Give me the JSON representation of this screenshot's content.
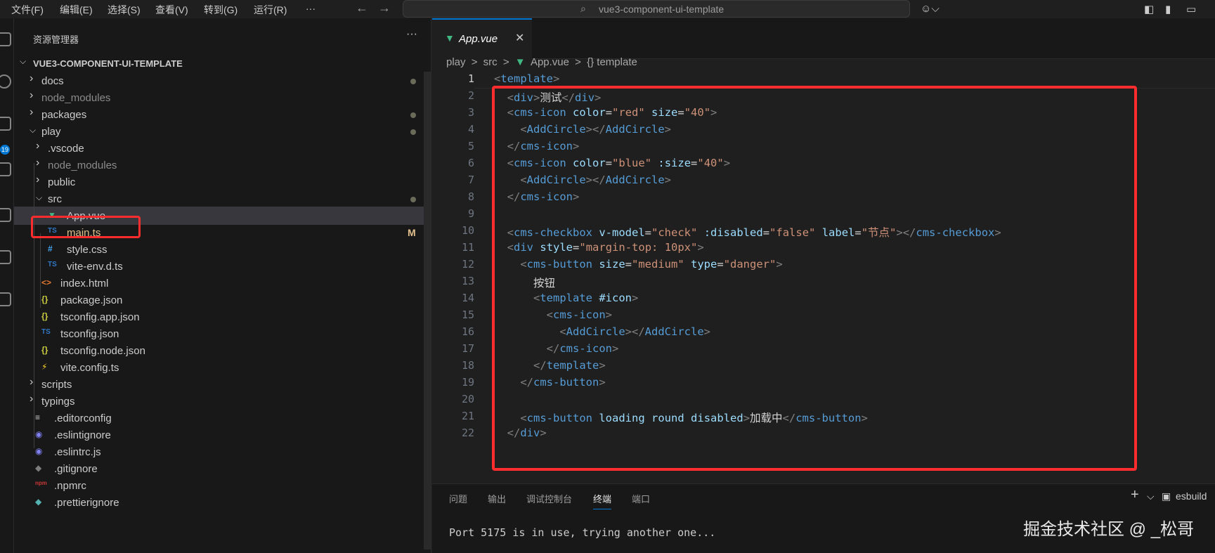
{
  "menu": [
    {
      "label": "文件(F)"
    },
    {
      "label": "编辑(E)"
    },
    {
      "label": "选择(S)"
    },
    {
      "label": "查看(V)"
    },
    {
      "label": "转到(G)"
    },
    {
      "label": "运行(R)"
    },
    {
      "label": "···"
    }
  ],
  "nav": {
    "back": "←",
    "forward": "→"
  },
  "command_center": {
    "icon": "search-icon",
    "text": "vue3-component-ui-template"
  },
  "activity": {
    "badge": "19"
  },
  "sidebar": {
    "title": "资源管理器",
    "more": "···",
    "root": "VUE3-COMPONENT-UI-TEMPLATE",
    "items": [
      {
        "label": "docs",
        "kind": "folder",
        "state": "collapsed",
        "badge": "dot"
      },
      {
        "label": "node_modules",
        "kind": "folder",
        "state": "collapsed",
        "dim": true
      },
      {
        "label": "packages",
        "kind": "folder",
        "state": "collapsed",
        "badge": "dot"
      },
      {
        "label": "play",
        "kind": "folder",
        "state": "expanded",
        "badge": "dot"
      },
      {
        "label": ".vscode",
        "kind": "folder",
        "state": "collapsed"
      },
      {
        "label": "node_modules",
        "kind": "folder",
        "state": "collapsed",
        "dim": true
      },
      {
        "label": "public",
        "kind": "folder",
        "state": "collapsed"
      },
      {
        "label": "src",
        "kind": "folder",
        "state": "expanded",
        "badge": "dot"
      },
      {
        "label": "App.vue",
        "kind": "vue",
        "selected": true
      },
      {
        "label": "main.ts",
        "kind": "ts",
        "icon_text": "TS",
        "badge": "M"
      },
      {
        "label": "style.css",
        "kind": "css",
        "icon_text": "#"
      },
      {
        "label": "vite-env.d.ts",
        "kind": "ts",
        "icon_text": "TS"
      },
      {
        "label": "index.html",
        "kind": "html",
        "icon_text": "<>"
      },
      {
        "label": "package.json",
        "kind": "json",
        "icon_text": "{}"
      },
      {
        "label": "tsconfig.app.json",
        "kind": "json",
        "icon_text": "{}"
      },
      {
        "label": "tsconfig.json",
        "kind": "tsconfig",
        "icon_text": "TS"
      },
      {
        "label": "tsconfig.node.json",
        "kind": "json",
        "icon_text": "{}"
      },
      {
        "label": "vite.config.ts",
        "kind": "vite",
        "icon_text": "⚡"
      },
      {
        "label": "scripts",
        "kind": "folder",
        "state": "collapsed"
      },
      {
        "label": "typings",
        "kind": "folder",
        "state": "collapsed"
      },
      {
        "label": ".editorconfig",
        "kind": "config",
        "icon_text": "≡"
      },
      {
        "label": ".eslintignore",
        "kind": "eslint",
        "icon_text": "◉"
      },
      {
        "label": ".eslintrc.js",
        "kind": "eslint",
        "icon_text": "◉"
      },
      {
        "label": ".gitignore",
        "kind": "git",
        "icon_text": "◆"
      },
      {
        "label": ".npmrc",
        "kind": "npm",
        "icon_text": "npm"
      },
      {
        "label": ".prettierignore",
        "kind": "prettier",
        "icon_text": "◆"
      }
    ]
  },
  "editor": {
    "tab": {
      "label": "App.vue",
      "close": "✕"
    },
    "breadcrumb": [
      "play",
      ">",
      "src",
      ">",
      "App.vue",
      ">",
      "{} template"
    ],
    "active_line": 1,
    "lines": [
      {
        "n": "1",
        "tokens": [
          [
            "pc",
            "<"
          ],
          [
            "tg",
            "template"
          ],
          [
            "pc",
            ">"
          ]
        ]
      },
      {
        "n": "2",
        "tokens": [
          [
            "tx",
            "  "
          ],
          [
            "pc",
            "<"
          ],
          [
            "tg",
            "div"
          ],
          [
            "pc",
            ">"
          ],
          [
            "tx",
            "测试"
          ],
          [
            "pc",
            "</"
          ],
          [
            "tg",
            "div"
          ],
          [
            "pc",
            ">"
          ]
        ]
      },
      {
        "n": "3",
        "tokens": [
          [
            "tx",
            "  "
          ],
          [
            "pc",
            "<"
          ],
          [
            "tg",
            "cms-icon"
          ],
          [
            "tx",
            " "
          ],
          [
            "at",
            "color"
          ],
          [
            "tx",
            "="
          ],
          [
            "sv",
            "\"red\""
          ],
          [
            "tx",
            " "
          ],
          [
            "at",
            "size"
          ],
          [
            "tx",
            "="
          ],
          [
            "sv",
            "\"40\""
          ],
          [
            "pc",
            ">"
          ]
        ]
      },
      {
        "n": "4",
        "tokens": [
          [
            "tx",
            "    "
          ],
          [
            "pc",
            "<"
          ],
          [
            "tg",
            "AddCircle"
          ],
          [
            "pc",
            "></"
          ],
          [
            "tg",
            "AddCircle"
          ],
          [
            "pc",
            ">"
          ]
        ]
      },
      {
        "n": "5",
        "tokens": [
          [
            "tx",
            "  "
          ],
          [
            "pc",
            "</"
          ],
          [
            "tg",
            "cms-icon"
          ],
          [
            "pc",
            ">"
          ]
        ]
      },
      {
        "n": "6",
        "tokens": [
          [
            "tx",
            "  "
          ],
          [
            "pc",
            "<"
          ],
          [
            "tg",
            "cms-icon"
          ],
          [
            "tx",
            " "
          ],
          [
            "at",
            "color"
          ],
          [
            "tx",
            "="
          ],
          [
            "sv",
            "\"blue\""
          ],
          [
            "tx",
            " "
          ],
          [
            "at",
            ":size"
          ],
          [
            "tx",
            "="
          ],
          [
            "sv",
            "\"40\""
          ],
          [
            "pc",
            ">"
          ]
        ]
      },
      {
        "n": "7",
        "tokens": [
          [
            "tx",
            "    "
          ],
          [
            "pc",
            "<"
          ],
          [
            "tg",
            "AddCircle"
          ],
          [
            "pc",
            "></"
          ],
          [
            "tg",
            "AddCircle"
          ],
          [
            "pc",
            ">"
          ]
        ]
      },
      {
        "n": "8",
        "tokens": [
          [
            "tx",
            "  "
          ],
          [
            "pc",
            "</"
          ],
          [
            "tg",
            "cms-icon"
          ],
          [
            "pc",
            ">"
          ]
        ]
      },
      {
        "n": "9",
        "tokens": []
      },
      {
        "n": "10",
        "tokens": [
          [
            "tx",
            "  "
          ],
          [
            "pc",
            "<"
          ],
          [
            "tg",
            "cms-checkbox"
          ],
          [
            "tx",
            " "
          ],
          [
            "at",
            "v-model"
          ],
          [
            "tx",
            "="
          ],
          [
            "sv",
            "\"check\""
          ],
          [
            "tx",
            " "
          ],
          [
            "at",
            ":disabled"
          ],
          [
            "tx",
            "="
          ],
          [
            "sv",
            "\"false\""
          ],
          [
            "tx",
            " "
          ],
          [
            "at",
            "label"
          ],
          [
            "tx",
            "="
          ],
          [
            "sv",
            "\"节点\""
          ],
          [
            "pc",
            "></"
          ],
          [
            "tg",
            "cms-checkbox"
          ],
          [
            "pc",
            ">"
          ]
        ]
      },
      {
        "n": "11",
        "tokens": [
          [
            "tx",
            "  "
          ],
          [
            "pc",
            "<"
          ],
          [
            "tg",
            "div"
          ],
          [
            "tx",
            " "
          ],
          [
            "at",
            "style"
          ],
          [
            "tx",
            "="
          ],
          [
            "sv",
            "\"margin-top: 10px\""
          ],
          [
            "pc",
            ">"
          ]
        ]
      },
      {
        "n": "12",
        "tokens": [
          [
            "tx",
            "    "
          ],
          [
            "pc",
            "<"
          ],
          [
            "tg",
            "cms-button"
          ],
          [
            "tx",
            " "
          ],
          [
            "at",
            "size"
          ],
          [
            "tx",
            "="
          ],
          [
            "sv",
            "\"medium\""
          ],
          [
            "tx",
            " "
          ],
          [
            "at",
            "type"
          ],
          [
            "tx",
            "="
          ],
          [
            "sv",
            "\"danger\""
          ],
          [
            "pc",
            ">"
          ]
        ]
      },
      {
        "n": "13",
        "tokens": [
          [
            "tx",
            "      按钮"
          ]
        ]
      },
      {
        "n": "14",
        "tokens": [
          [
            "tx",
            "      "
          ],
          [
            "pc",
            "<"
          ],
          [
            "tg",
            "template"
          ],
          [
            "tx",
            " "
          ],
          [
            "at",
            "#icon"
          ],
          [
            "pc",
            ">"
          ]
        ]
      },
      {
        "n": "15",
        "tokens": [
          [
            "tx",
            "        "
          ],
          [
            "pc",
            "<"
          ],
          [
            "tg",
            "cms-icon"
          ],
          [
            "pc",
            ">"
          ]
        ]
      },
      {
        "n": "16",
        "tokens": [
          [
            "tx",
            "          "
          ],
          [
            "pc",
            "<"
          ],
          [
            "tg",
            "AddCircle"
          ],
          [
            "pc",
            "></"
          ],
          [
            "tg",
            "AddCircle"
          ],
          [
            "pc",
            ">"
          ]
        ]
      },
      {
        "n": "17",
        "tokens": [
          [
            "tx",
            "        "
          ],
          [
            "pc",
            "</"
          ],
          [
            "tg",
            "cms-icon"
          ],
          [
            "pc",
            ">"
          ]
        ]
      },
      {
        "n": "18",
        "tokens": [
          [
            "tx",
            "      "
          ],
          [
            "pc",
            "</"
          ],
          [
            "tg",
            "template"
          ],
          [
            "pc",
            ">"
          ]
        ]
      },
      {
        "n": "19",
        "tokens": [
          [
            "tx",
            "    "
          ],
          [
            "pc",
            "</"
          ],
          [
            "tg",
            "cms-button"
          ],
          [
            "pc",
            ">"
          ]
        ]
      },
      {
        "n": "20",
        "tokens": []
      },
      {
        "n": "21",
        "tokens": [
          [
            "tx",
            "    "
          ],
          [
            "pc",
            "<"
          ],
          [
            "tg",
            "cms-button"
          ],
          [
            "tx",
            " "
          ],
          [
            "at",
            "loading"
          ],
          [
            "tx",
            " "
          ],
          [
            "at",
            "round"
          ],
          [
            "tx",
            " "
          ],
          [
            "at",
            "disabled"
          ],
          [
            "pc",
            ">"
          ],
          [
            "tx",
            "加载中"
          ],
          [
            "pc",
            "</"
          ],
          [
            "tg",
            "cms-button"
          ],
          [
            "pc",
            ">"
          ]
        ]
      },
      {
        "n": "22",
        "tokens": [
          [
            "tx",
            "  "
          ],
          [
            "pc",
            "</"
          ],
          [
            "tg",
            "div"
          ],
          [
            "pc",
            ">"
          ]
        ]
      }
    ]
  },
  "panel": {
    "tabs": [
      {
        "label": "问题"
      },
      {
        "label": "输出"
      },
      {
        "label": "调试控制台"
      },
      {
        "label": "终端",
        "active": true
      },
      {
        "label": "端口"
      }
    ],
    "add": "+",
    "dropdown": "⌵",
    "terminal_name": "esbuild",
    "terminal_output": "Port 5175 is in use, trying another one..."
  },
  "watermark": "掘金技术社区 @ _松哥"
}
